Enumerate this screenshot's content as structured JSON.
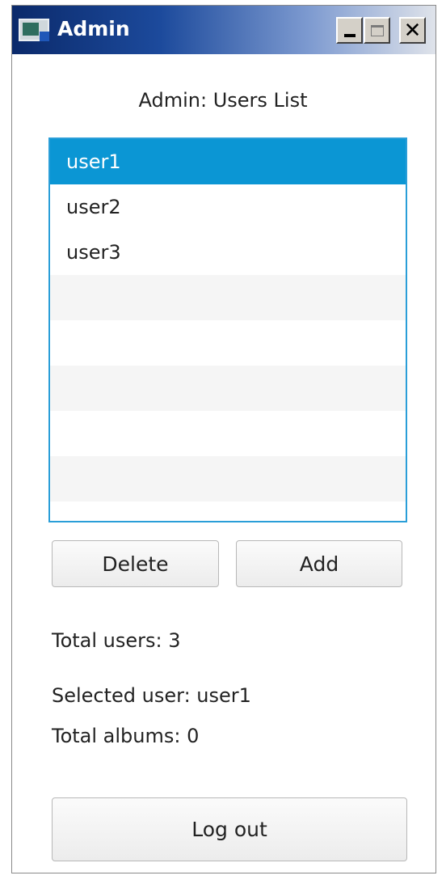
{
  "window": {
    "title": "Admin"
  },
  "heading": "Admin: Users List",
  "users_list": {
    "items": [
      "user1",
      "user2",
      "user3"
    ],
    "selected_index": 0
  },
  "buttons": {
    "delete": "Delete",
    "add": "Add",
    "logout": "Log out"
  },
  "stats": {
    "total_users": "Total users: 3",
    "selected_user": "Selected user: user1",
    "total_albums": "Total albums: 0"
  },
  "colors": {
    "selection": "#0b96d4",
    "list_border": "#2a9ed8",
    "titlebar_start": "#0b2a6b"
  },
  "icons": {
    "app": "window-app-icon",
    "minimize": "minimize-icon",
    "maximize": "maximize-icon",
    "close": "close-icon"
  }
}
